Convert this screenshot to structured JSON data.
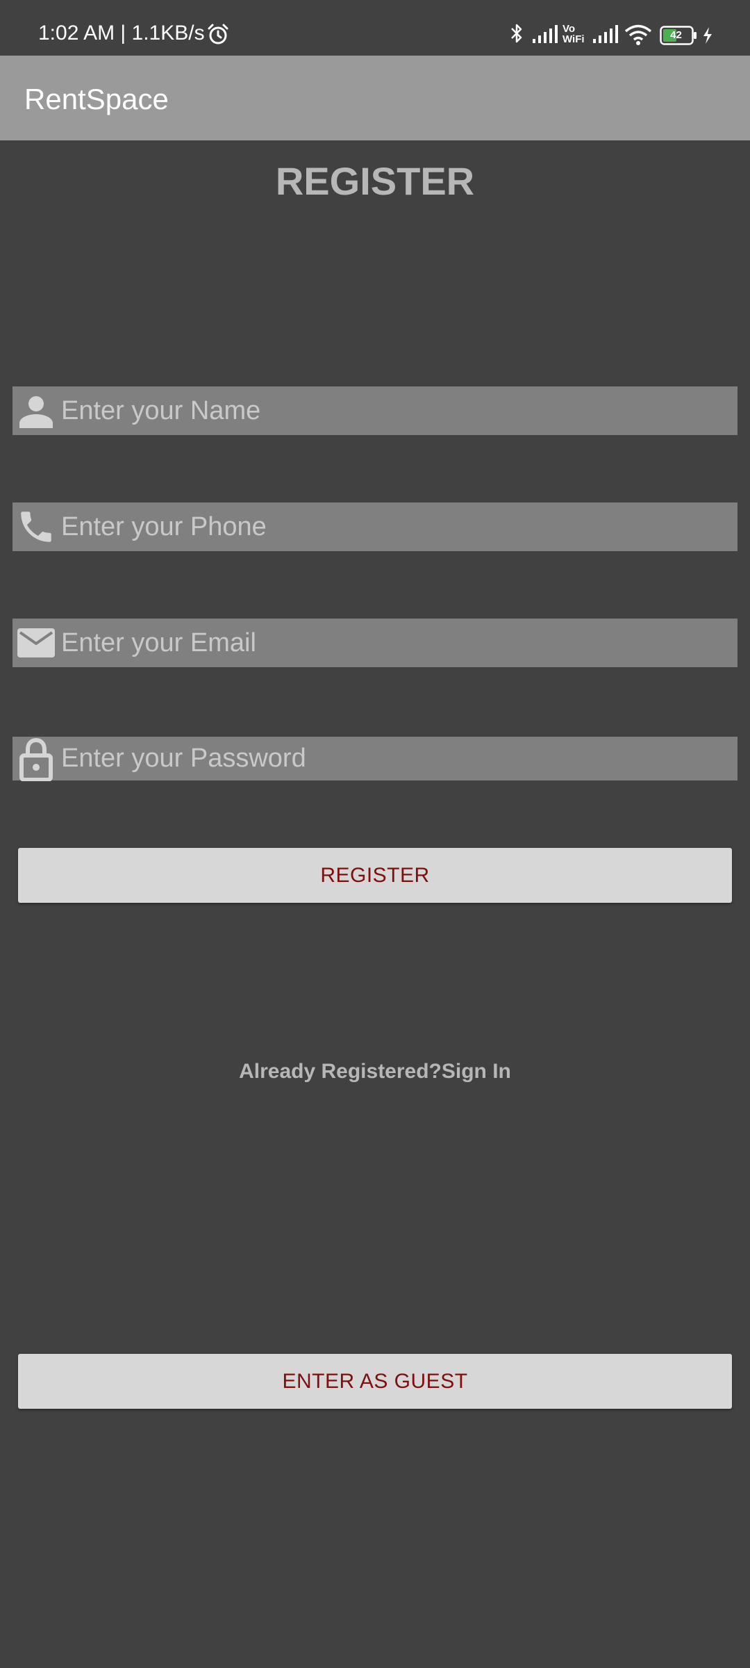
{
  "status_bar": {
    "time_text": "1:02 AM | 1.1KB/s",
    "vowifi_label": "Vo WiFi",
    "battery_level": "42",
    "icons": [
      "alarm-icon",
      "bluetooth-icon",
      "signal-icon",
      "signal-icon",
      "wifi-icon",
      "battery-icon",
      "charging-icon"
    ]
  },
  "app_bar": {
    "title": "RentSpace"
  },
  "page": {
    "heading": "REGISTER"
  },
  "form": {
    "name": {
      "icon": "person-icon",
      "value": "",
      "placeholder": "Enter your Name"
    },
    "phone": {
      "icon": "phone-icon",
      "value": "",
      "placeholder": "Enter your Phone"
    },
    "email": {
      "icon": "mail-icon",
      "value": "",
      "placeholder": "Enter your Email"
    },
    "password": {
      "icon": "lock-icon",
      "value": "",
      "placeholder": "Enter your Password"
    },
    "register_label": "REGISTER",
    "sign_in_text": "Already Registered?Sign In",
    "guest_label": "ENTER AS GUEST"
  },
  "colors": {
    "background": "#414141",
    "app_bar": "#9a9a9a",
    "input_background": "#808080",
    "button_background": "#d6d7d6",
    "button_text": "#7d0f0f",
    "muted_text": "#b7b7b7"
  }
}
